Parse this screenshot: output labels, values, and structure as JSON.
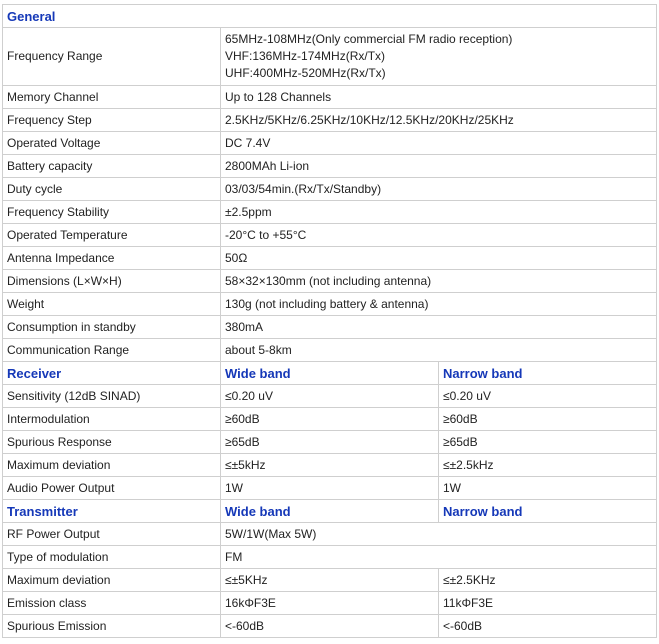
{
  "general": {
    "title": "General",
    "frequency_range": {
      "label": "Frequency Range",
      "lines": [
        "65MHz-108MHz(Only commercial FM radio reception)",
        "VHF:136MHz-174MHz(Rx/Tx)",
        "UHF:400MHz-520MHz(Rx/Tx)"
      ]
    },
    "rows": [
      {
        "label": "Memory Channel",
        "value": "Up to 128 Channels"
      },
      {
        "label": "Frequency Step",
        "value": "2.5KHz/5KHz/6.25KHz/10KHz/12.5KHz/20KHz/25KHz"
      },
      {
        "label": "Operated Voltage",
        "value": "DC 7.4V"
      },
      {
        "label": "Battery capacity",
        "value": "2800MAh Li-ion"
      },
      {
        "label": "Duty cycle",
        "value": "03/03/54min.(Rx/Tx/Standby)"
      },
      {
        "label": "Frequency Stability",
        "value": "±2.5ppm"
      },
      {
        "label": "Operated Temperature",
        "value": "-20°C to +55°C"
      },
      {
        "label": "Antenna Impedance",
        "value": "50Ω"
      },
      {
        "label": "Dimensions (L×W×H)",
        "value": "58×32×130mm (not including antenna)"
      },
      {
        "label": "Weight",
        "value": "130g (not including battery & antenna)"
      },
      {
        "label": "Consumption in standby",
        "value": "380mA"
      },
      {
        "label": "Communication Range",
        "value": "about 5-8km"
      }
    ]
  },
  "receiver": {
    "title": "Receiver",
    "wide_header": "Wide band",
    "narrow_header": "Narrow band",
    "rows": [
      {
        "label": "Sensitivity (12dB SINAD)",
        "wide": "≤0.20 uV",
        "narrow": "≤0.20 uV"
      },
      {
        "label": "Intermodulation",
        "wide": "≥60dB",
        "narrow": "≥60dB"
      },
      {
        "label": "Spurious Response",
        "wide": "≥65dB",
        "narrow": "≥65dB"
      },
      {
        "label": "Maximum deviation",
        "wide": "≤±5kHz",
        "narrow": "≤±2.5kHz"
      },
      {
        "label": "Audio Power Output",
        "wide": "1W",
        "narrow": "1W"
      }
    ]
  },
  "transmitter": {
    "title": "Transmitter",
    "wide_header": "Wide band",
    "narrow_header": "Narrow band",
    "rf_power": {
      "label": "RF Power Output",
      "value": "5W/1W(Max 5W)"
    },
    "modulation": {
      "label": "Type of modulation",
      "value": "FM"
    },
    "rows": [
      {
        "label": "Maximum deviation",
        "wide": "≤±5KHz",
        "narrow": "≤±2.5KHz"
      },
      {
        "label": "Emission class",
        "wide": "16kΦF3E",
        "narrow": "11kΦF3E"
      },
      {
        "label": "Spurious Emission",
        "wide": "<-60dB",
        "narrow": "<-60dB"
      }
    ]
  }
}
